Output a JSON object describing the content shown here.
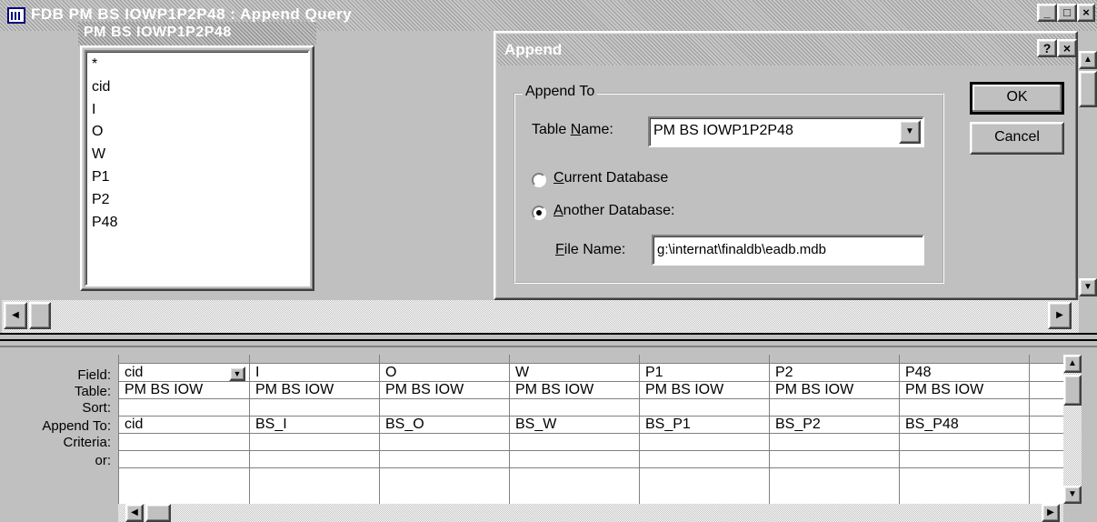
{
  "window": {
    "title": "FDB PM BS IOWP1P2P48 : Append Query",
    "minimize_glyph": "_",
    "maximize_glyph": "□",
    "close_glyph": "×"
  },
  "field_list": {
    "title": "PM BS IOWP1P2P48",
    "items": [
      "*",
      "cid",
      "I",
      "O",
      "W",
      "P1",
      "P2",
      "P48"
    ]
  },
  "append_dialog": {
    "title": "Append",
    "help_glyph": "?",
    "close_glyph": "×",
    "group_label": "Append To",
    "table_name_label_pre": "Table ",
    "table_name_label_key": "N",
    "table_name_label_post": "ame:",
    "table_name_value": "PM BS IOWP1P2P48",
    "current_db_key": "C",
    "current_db_rest": "urrent Database",
    "another_db_key": "A",
    "another_db_rest": "nother Database:",
    "selected_option": "another",
    "file_name_key": "F",
    "file_name_rest": "ile Name:",
    "file_name_value": "g:\\internat\\finaldb\\eadb.mdb",
    "ok_label": "OK",
    "cancel_label": "Cancel"
  },
  "grid": {
    "row_labels": [
      "Field:",
      "Table:",
      "Sort:",
      "Append To:",
      "Criteria:",
      "or:"
    ],
    "columns": [
      {
        "field": "cid",
        "table": "PM BS IOW",
        "sort": "",
        "append_to": "cid",
        "criteria": "",
        "or": ""
      },
      {
        "field": "I",
        "table": "PM BS IOW",
        "sort": "",
        "append_to": "BS_I",
        "criteria": "",
        "or": ""
      },
      {
        "field": "O",
        "table": "PM BS IOW",
        "sort": "",
        "append_to": "BS_O",
        "criteria": "",
        "or": ""
      },
      {
        "field": "W",
        "table": "PM BS IOW",
        "sort": "",
        "append_to": "BS_W",
        "criteria": "",
        "or": ""
      },
      {
        "field": "P1",
        "table": "PM BS IOW",
        "sort": "",
        "append_to": "BS_P1",
        "criteria": "",
        "or": ""
      },
      {
        "field": "P2",
        "table": "PM BS IOW",
        "sort": "",
        "append_to": "BS_P2",
        "criteria": "",
        "or": ""
      },
      {
        "field": "P48",
        "table": "PM BS IOW",
        "sort": "",
        "append_to": "BS_P48",
        "criteria": "",
        "or": ""
      },
      {
        "field": "",
        "table": "",
        "sort": "",
        "append_to": "",
        "criteria": "",
        "or": ""
      }
    ]
  },
  "scroll_glyphs": {
    "up": "▲",
    "down": "▼",
    "left": "◀",
    "right": "▶"
  },
  "colors": {
    "face": "#c0c0c0",
    "shadow": "#808080",
    "highlight": "#ffffff",
    "window": "#ffffff"
  }
}
